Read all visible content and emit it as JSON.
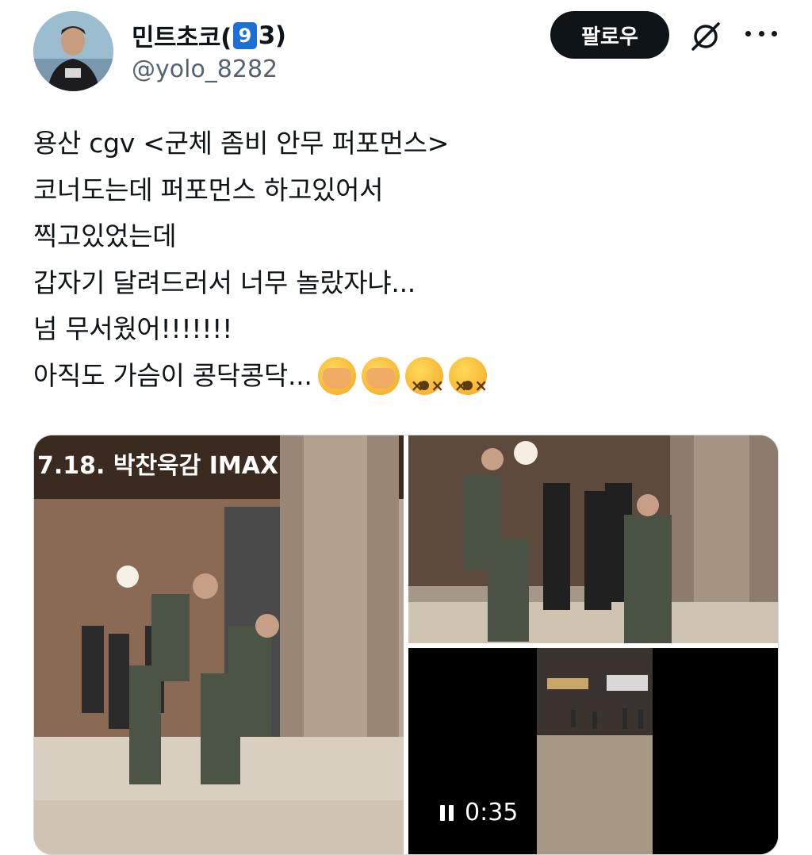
{
  "user": {
    "display_name_prefix": "민트초코(",
    "badge_number": "9",
    "display_name_suffix": "3)",
    "handle": "@yolo_8282"
  },
  "actions": {
    "follow_label": "팔로우",
    "grok_icon": "slashed-circle-icon",
    "more_icon": "more-horizontal-icon"
  },
  "tweet": {
    "lines": [
      "용산 cgv <군체 좀비 안무 퍼포먼스>",
      "코너도는데 퍼포먼스 하고있어서",
      "찍고있었는데",
      "갑자기 달려드러서 너무 놀랐자냐...",
      "넘 무서웠어!!!!!!!",
      "아직도 가슴이 콩닥콩닥..."
    ],
    "emojis": [
      "face-with-hands-over-mouth",
      "face-with-hands-over-mouth",
      "dizzy-face",
      "dizzy-face"
    ]
  },
  "media": {
    "photo1_sign": "7.18. 박찬욱감 IMAX",
    "video_time": "0:35"
  },
  "colors": {
    "text": "#0f1419",
    "secondary": "#536471",
    "follow_bg": "#0f1419",
    "badge_blue": "#1d6fd6"
  }
}
